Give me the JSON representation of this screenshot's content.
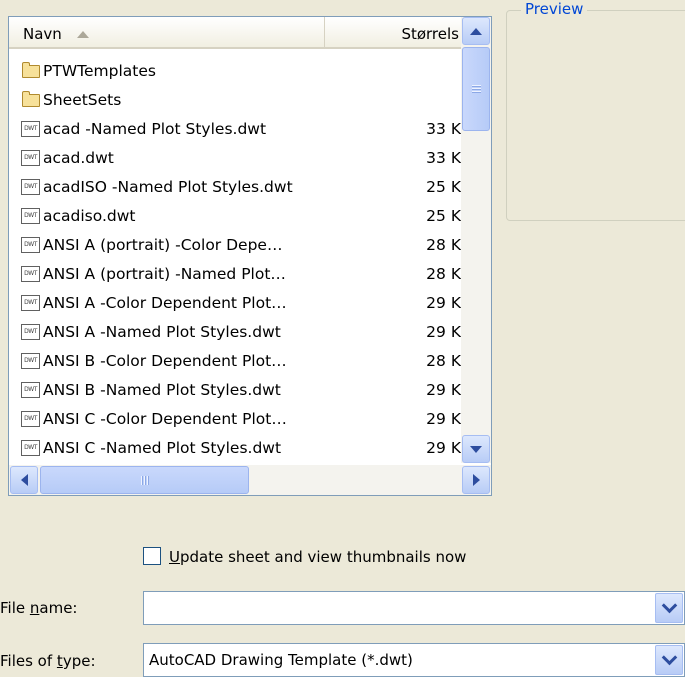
{
  "file_list": {
    "columns": {
      "name": "Navn",
      "size": "Størrels"
    },
    "rows": [
      {
        "kind": "folder",
        "name": "PTWTemplates",
        "size": ""
      },
      {
        "kind": "folder",
        "name": "SheetSets",
        "size": ""
      },
      {
        "kind": "dwt",
        "name": "acad -Named Plot Styles.dwt",
        "size": "33 K"
      },
      {
        "kind": "dwt",
        "name": "acad.dwt",
        "size": "33 K"
      },
      {
        "kind": "dwt",
        "name": "acadISO -Named Plot Styles.dwt",
        "size": "25 K"
      },
      {
        "kind": "dwt",
        "name": "acadiso.dwt",
        "size": "25 K"
      },
      {
        "kind": "dwt",
        "name": "ANSI A (portrait) -Color Depe…",
        "size": "28 K"
      },
      {
        "kind": "dwt",
        "name": "ANSI A (portrait) -Named Plot…",
        "size": "28 K"
      },
      {
        "kind": "dwt",
        "name": "ANSI A -Color Dependent Plot…",
        "size": "29 K"
      },
      {
        "kind": "dwt",
        "name": "ANSI A -Named Plot Styles.dwt",
        "size": "29 K"
      },
      {
        "kind": "dwt",
        "name": "ANSI B -Color Dependent Plot…",
        "size": "28 K"
      },
      {
        "kind": "dwt",
        "name": "ANSI B -Named Plot Styles.dwt",
        "size": "29 K"
      },
      {
        "kind": "dwt",
        "name": "ANSI C -Color Dependent Plot…",
        "size": "29 K"
      },
      {
        "kind": "dwt",
        "name": "ANSI C -Named Plot Styles.dwt",
        "size": "29 K"
      }
    ],
    "dwt_icon_text": "DWT"
  },
  "preview": {
    "label": "Preview"
  },
  "update_thumbnails": {
    "label_u": "U",
    "label_rest": "pdate sheet and view thumbnails now",
    "checked": false
  },
  "file_name": {
    "label_pre": "File ",
    "label_u": "n",
    "label_post": "ame:",
    "value": ""
  },
  "file_type": {
    "label_pre": "Files of ",
    "label_u": "t",
    "label_post": "ype:",
    "value": "AutoCAD Drawing Template (*.dwt)"
  },
  "colors": {
    "dialog_bg": "#ECE9D8",
    "list_border": "#7F9DB9",
    "accent_blue": "#2D4D9F",
    "preview_label": "#0046D5"
  }
}
